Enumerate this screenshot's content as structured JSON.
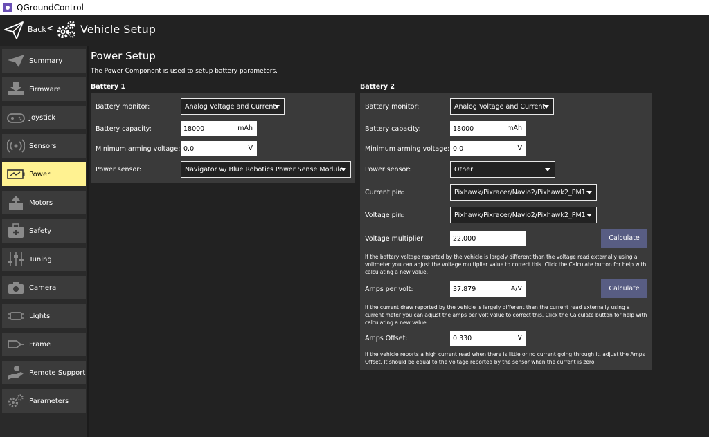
{
  "window": {
    "title": "QGroundControl"
  },
  "toolbar": {
    "back_label": "Back",
    "separator": "<",
    "title": "Vehicle Setup"
  },
  "sidebar": {
    "items": [
      {
        "label": "Summary",
        "icon": "plane-icon"
      },
      {
        "label": "Firmware",
        "icon": "download-icon"
      },
      {
        "label": "Joystick",
        "icon": "gamepad-icon"
      },
      {
        "label": "Sensors",
        "icon": "radio-waves-icon"
      },
      {
        "label": "Power",
        "icon": "battery-icon",
        "active": true
      },
      {
        "label": "Motors",
        "icon": "motor-icon"
      },
      {
        "label": "Safety",
        "icon": "first-aid-icon"
      },
      {
        "label": "Tuning",
        "icon": "sliders-icon"
      },
      {
        "label": "Camera",
        "icon": "camera-icon"
      },
      {
        "label": "Lights",
        "icon": "lights-icon"
      },
      {
        "label": "Frame",
        "icon": "frame-icon"
      },
      {
        "label": "Remote Support",
        "icon": "support-hand-icon"
      },
      {
        "label": "Parameters",
        "icon": "gears-icon"
      }
    ]
  },
  "page": {
    "title": "Power Setup",
    "description": "The Power Component is used to setup battery parameters."
  },
  "battery1": {
    "title": "Battery 1",
    "monitor_label": "Battery monitor:",
    "monitor_value": "Analog Voltage and Current",
    "capacity_label": "Battery capacity:",
    "capacity_value": "18000",
    "capacity_unit": "mAh",
    "min_voltage_label": "Minimum arming voltage:",
    "min_voltage_value": "0.0",
    "min_voltage_unit": "V",
    "sensor_label": "Power sensor:",
    "sensor_value": "Navigator w/ Blue Robotics Power Sense Module"
  },
  "battery2": {
    "title": "Battery 2",
    "monitor_label": "Battery monitor:",
    "monitor_value": "Analog Voltage and Current",
    "capacity_label": "Battery capacity:",
    "capacity_value": "18000",
    "capacity_unit": "mAh",
    "min_voltage_label": "Minimum arming voltage:",
    "min_voltage_value": "0.0",
    "min_voltage_unit": "V",
    "sensor_label": "Power sensor:",
    "sensor_value": "Other",
    "current_pin_label": "Current pin:",
    "current_pin_value": "Pixhawk/Pixracer/Navio2/Pixhawk2_PM1",
    "voltage_pin_label": "Voltage pin:",
    "voltage_pin_value": "Pixhawk/Pixracer/Navio2/Pixhawk2_PM1",
    "voltage_mult_label": "Voltage multiplier:",
    "voltage_mult_value": "22.000",
    "voltage_mult_button": "Calculate",
    "voltage_mult_help": "If the battery voltage reported by the vehicle is largely different than the voltage read externally using a voltmeter you can adjust the voltage multiplier value to correct this. Click the Calculate button for help with calculating a new value.",
    "amps_per_volt_label": "Amps per volt:",
    "amps_per_volt_value": "37.879",
    "amps_per_volt_unit": "A/V",
    "amps_per_volt_button": "Calculate",
    "amps_per_volt_help": "If the current draw reported by the vehicle is largely different than the current read externally using a current meter you can adjust the amps per volt value to correct this. Click the Calculate button for help with calculating a new value.",
    "amps_offset_label": "Amps Offset:",
    "amps_offset_value": "0.330",
    "amps_offset_unit": "V",
    "amps_offset_help": "If the vehicle reports a high current read when there is little or no current going through it, adjust the Amps Offset. It should be equal to the voltage reported by the sensor when the current is zero."
  },
  "colors": {
    "background": "#222222",
    "panel": "#3a3a3a",
    "sidebar_item": "#3b3b3b",
    "active_item": "#fff291",
    "button": "#585d83"
  }
}
